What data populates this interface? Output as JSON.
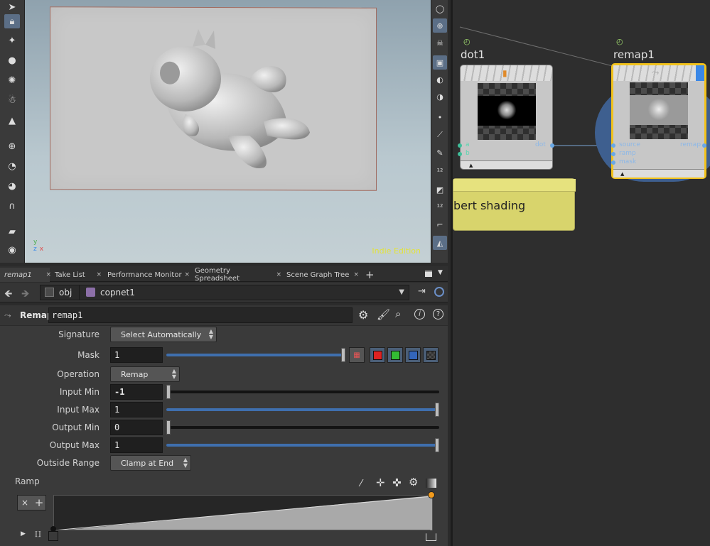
{
  "viewport": {
    "edition_label": "Indie Edition",
    "axis_y": "y",
    "axis_z": "z",
    "axis_x": "x"
  },
  "tabs": [
    {
      "label": "remap1",
      "active": true
    },
    {
      "label": "Take List",
      "active": false
    },
    {
      "label": "Performance Monitor",
      "active": false
    },
    {
      "label": "Geometry Spreadsheet",
      "active": false
    },
    {
      "label": "Scene Graph Tree",
      "active": false
    }
  ],
  "tab_close_glyph": "×",
  "tab_add_glyph": "+",
  "path": {
    "segment1": "obj",
    "segment2": "copnet1"
  },
  "node_header": {
    "type_label": "Remap",
    "name_value": "remap1"
  },
  "params": {
    "signature": {
      "label": "Signature",
      "value": "Select Automatically"
    },
    "mask": {
      "label": "Mask",
      "value": "1",
      "slider_fraction": 1.0
    },
    "operation": {
      "label": "Operation",
      "value": "Remap"
    },
    "input_min": {
      "label": "Input Min",
      "value": "-1",
      "slider_fraction": 0.0
    },
    "input_max": {
      "label": "Input Max",
      "value": "1",
      "slider_fraction": 1.0
    },
    "output_min": {
      "label": "Output Min",
      "value": "0",
      "slider_fraction": 0.0
    },
    "output_max": {
      "label": "Output Max",
      "value": "1",
      "slider_fraction": 1.0
    },
    "outside_range": {
      "label": "Outside Range",
      "value": "Clamp at End"
    },
    "ramp": {
      "label": "Ramp",
      "remove_glyph": "×",
      "add_glyph": "+"
    }
  },
  "mask_channel_colors": [
    "#dd2222",
    "#33bb33",
    "#3366bb"
  ],
  "network": {
    "dot_node": {
      "title": "dot1",
      "in_a": "a",
      "in_b": "b",
      "out": "dot"
    },
    "remap_node": {
      "title": "remap1",
      "in_source": "source",
      "in_ramp": "ramp",
      "in_mask": "mask",
      "out": "remap"
    },
    "sticky_text": "bert shading"
  },
  "colors": {
    "accent_blue": "#3f6fae",
    "selected_yellow": "#f2c21b",
    "sticky_yellow": "#d8d46c",
    "indie_text": "#e3e33a"
  }
}
